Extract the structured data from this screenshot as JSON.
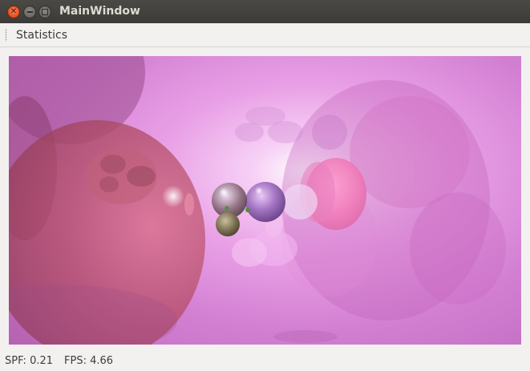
{
  "window": {
    "title": "MainWindow"
  },
  "menubar": {
    "items": [
      {
        "label": "Statistics"
      }
    ]
  },
  "viewport": {
    "content": "raytraced-spheres"
  },
  "statusbar": {
    "spf": "SPF: 0.21",
    "fps": "FPS: 4.66"
  },
  "colors": {
    "titlebar": "#3c3b37",
    "close_button": "#e9541f",
    "scene_background": "#d27fd2"
  }
}
